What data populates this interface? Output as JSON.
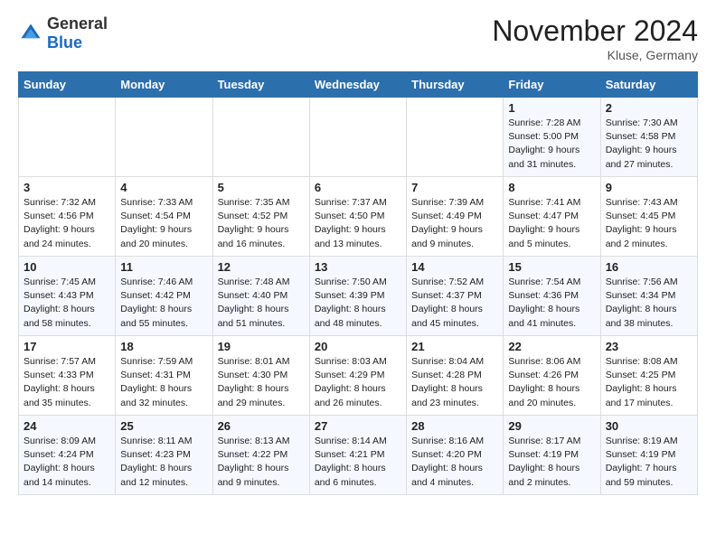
{
  "header": {
    "logo_general": "General",
    "logo_blue": "Blue",
    "title": "November 2024",
    "location": "Kluse, Germany"
  },
  "weekdays": [
    "Sunday",
    "Monday",
    "Tuesday",
    "Wednesday",
    "Thursday",
    "Friday",
    "Saturday"
  ],
  "weeks": [
    [
      {
        "day": "",
        "info": ""
      },
      {
        "day": "",
        "info": ""
      },
      {
        "day": "",
        "info": ""
      },
      {
        "day": "",
        "info": ""
      },
      {
        "day": "",
        "info": ""
      },
      {
        "day": "1",
        "info": "Sunrise: 7:28 AM\nSunset: 5:00 PM\nDaylight: 9 hours\nand 31 minutes."
      },
      {
        "day": "2",
        "info": "Sunrise: 7:30 AM\nSunset: 4:58 PM\nDaylight: 9 hours\nand 27 minutes."
      }
    ],
    [
      {
        "day": "3",
        "info": "Sunrise: 7:32 AM\nSunset: 4:56 PM\nDaylight: 9 hours\nand 24 minutes."
      },
      {
        "day": "4",
        "info": "Sunrise: 7:33 AM\nSunset: 4:54 PM\nDaylight: 9 hours\nand 20 minutes."
      },
      {
        "day": "5",
        "info": "Sunrise: 7:35 AM\nSunset: 4:52 PM\nDaylight: 9 hours\nand 16 minutes."
      },
      {
        "day": "6",
        "info": "Sunrise: 7:37 AM\nSunset: 4:50 PM\nDaylight: 9 hours\nand 13 minutes."
      },
      {
        "day": "7",
        "info": "Sunrise: 7:39 AM\nSunset: 4:49 PM\nDaylight: 9 hours\nand 9 minutes."
      },
      {
        "day": "8",
        "info": "Sunrise: 7:41 AM\nSunset: 4:47 PM\nDaylight: 9 hours\nand 5 minutes."
      },
      {
        "day": "9",
        "info": "Sunrise: 7:43 AM\nSunset: 4:45 PM\nDaylight: 9 hours\nand 2 minutes."
      }
    ],
    [
      {
        "day": "10",
        "info": "Sunrise: 7:45 AM\nSunset: 4:43 PM\nDaylight: 8 hours\nand 58 minutes."
      },
      {
        "day": "11",
        "info": "Sunrise: 7:46 AM\nSunset: 4:42 PM\nDaylight: 8 hours\nand 55 minutes."
      },
      {
        "day": "12",
        "info": "Sunrise: 7:48 AM\nSunset: 4:40 PM\nDaylight: 8 hours\nand 51 minutes."
      },
      {
        "day": "13",
        "info": "Sunrise: 7:50 AM\nSunset: 4:39 PM\nDaylight: 8 hours\nand 48 minutes."
      },
      {
        "day": "14",
        "info": "Sunrise: 7:52 AM\nSunset: 4:37 PM\nDaylight: 8 hours\nand 45 minutes."
      },
      {
        "day": "15",
        "info": "Sunrise: 7:54 AM\nSunset: 4:36 PM\nDaylight: 8 hours\nand 41 minutes."
      },
      {
        "day": "16",
        "info": "Sunrise: 7:56 AM\nSunset: 4:34 PM\nDaylight: 8 hours\nand 38 minutes."
      }
    ],
    [
      {
        "day": "17",
        "info": "Sunrise: 7:57 AM\nSunset: 4:33 PM\nDaylight: 8 hours\nand 35 minutes."
      },
      {
        "day": "18",
        "info": "Sunrise: 7:59 AM\nSunset: 4:31 PM\nDaylight: 8 hours\nand 32 minutes."
      },
      {
        "day": "19",
        "info": "Sunrise: 8:01 AM\nSunset: 4:30 PM\nDaylight: 8 hours\nand 29 minutes."
      },
      {
        "day": "20",
        "info": "Sunrise: 8:03 AM\nSunset: 4:29 PM\nDaylight: 8 hours\nand 26 minutes."
      },
      {
        "day": "21",
        "info": "Sunrise: 8:04 AM\nSunset: 4:28 PM\nDaylight: 8 hours\nand 23 minutes."
      },
      {
        "day": "22",
        "info": "Sunrise: 8:06 AM\nSunset: 4:26 PM\nDaylight: 8 hours\nand 20 minutes."
      },
      {
        "day": "23",
        "info": "Sunrise: 8:08 AM\nSunset: 4:25 PM\nDaylight: 8 hours\nand 17 minutes."
      }
    ],
    [
      {
        "day": "24",
        "info": "Sunrise: 8:09 AM\nSunset: 4:24 PM\nDaylight: 8 hours\nand 14 minutes."
      },
      {
        "day": "25",
        "info": "Sunrise: 8:11 AM\nSunset: 4:23 PM\nDaylight: 8 hours\nand 12 minutes."
      },
      {
        "day": "26",
        "info": "Sunrise: 8:13 AM\nSunset: 4:22 PM\nDaylight: 8 hours\nand 9 minutes."
      },
      {
        "day": "27",
        "info": "Sunrise: 8:14 AM\nSunset: 4:21 PM\nDaylight: 8 hours\nand 6 minutes."
      },
      {
        "day": "28",
        "info": "Sunrise: 8:16 AM\nSunset: 4:20 PM\nDaylight: 8 hours\nand 4 minutes."
      },
      {
        "day": "29",
        "info": "Sunrise: 8:17 AM\nSunset: 4:19 PM\nDaylight: 8 hours\nand 2 minutes."
      },
      {
        "day": "30",
        "info": "Sunrise: 8:19 AM\nSunset: 4:19 PM\nDaylight: 7 hours\nand 59 minutes."
      }
    ]
  ]
}
